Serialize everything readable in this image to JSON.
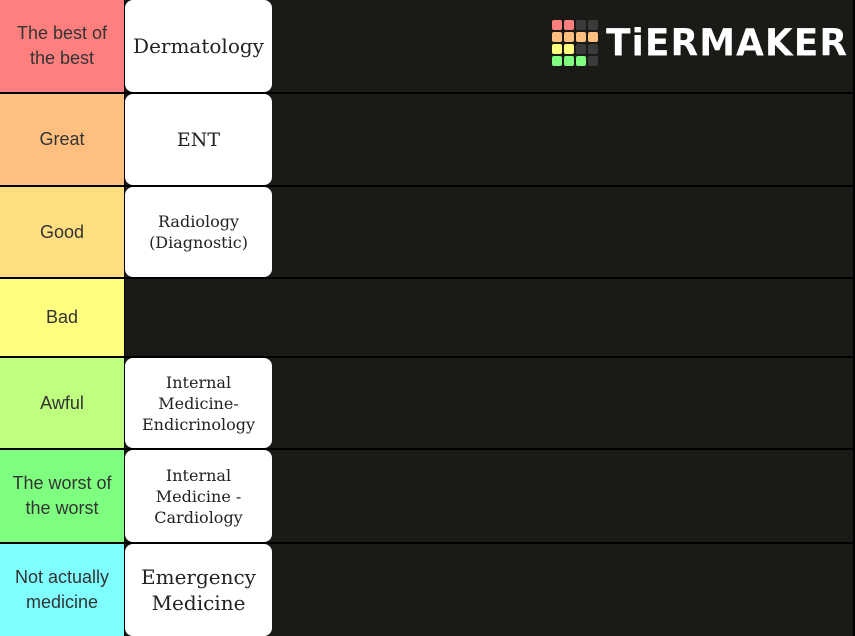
{
  "brand": {
    "name": "TiERMAKER",
    "grid_colors": [
      [
        "#ff7f7f",
        "#ff7f7f",
        "#3a3a3a",
        "#3a3a3a"
      ],
      [
        "#ffbf7f",
        "#ffbf7f",
        "#ffbf7f",
        "#ffbf7f"
      ],
      [
        "#ffff7f",
        "#ffff7f",
        "#3a3a3a",
        "#3a3a3a"
      ],
      [
        "#7fff7f",
        "#7fff7f",
        "#7fff7f",
        "#3a3a3a"
      ]
    ]
  },
  "tiers": [
    {
      "label": "The best of the best",
      "color": "#ff7f7f",
      "items": [
        {
          "text": "Dermatology"
        }
      ]
    },
    {
      "label": "Great",
      "color": "#ffbf7f",
      "items": [
        {
          "text": "ENT"
        }
      ]
    },
    {
      "label": "Good",
      "color": "#ffdf7f",
      "items": [
        {
          "text": "Radiology (Diagnostic)"
        }
      ]
    },
    {
      "label": "Bad",
      "color": "#ffff7f",
      "items": []
    },
    {
      "label": "Awful",
      "color": "#bfff7f",
      "items": [
        {
          "text": "Internal Medicine-Endicrinology"
        }
      ]
    },
    {
      "label": "The worst of the worst",
      "color": "#7fff7f",
      "items": [
        {
          "text": "Internal Medicine - Cardiology"
        }
      ]
    },
    {
      "label": "Not actually medicine",
      "color": "#7fffff",
      "items": [
        {
          "text": "Emergency Medicine"
        }
      ]
    }
  ]
}
